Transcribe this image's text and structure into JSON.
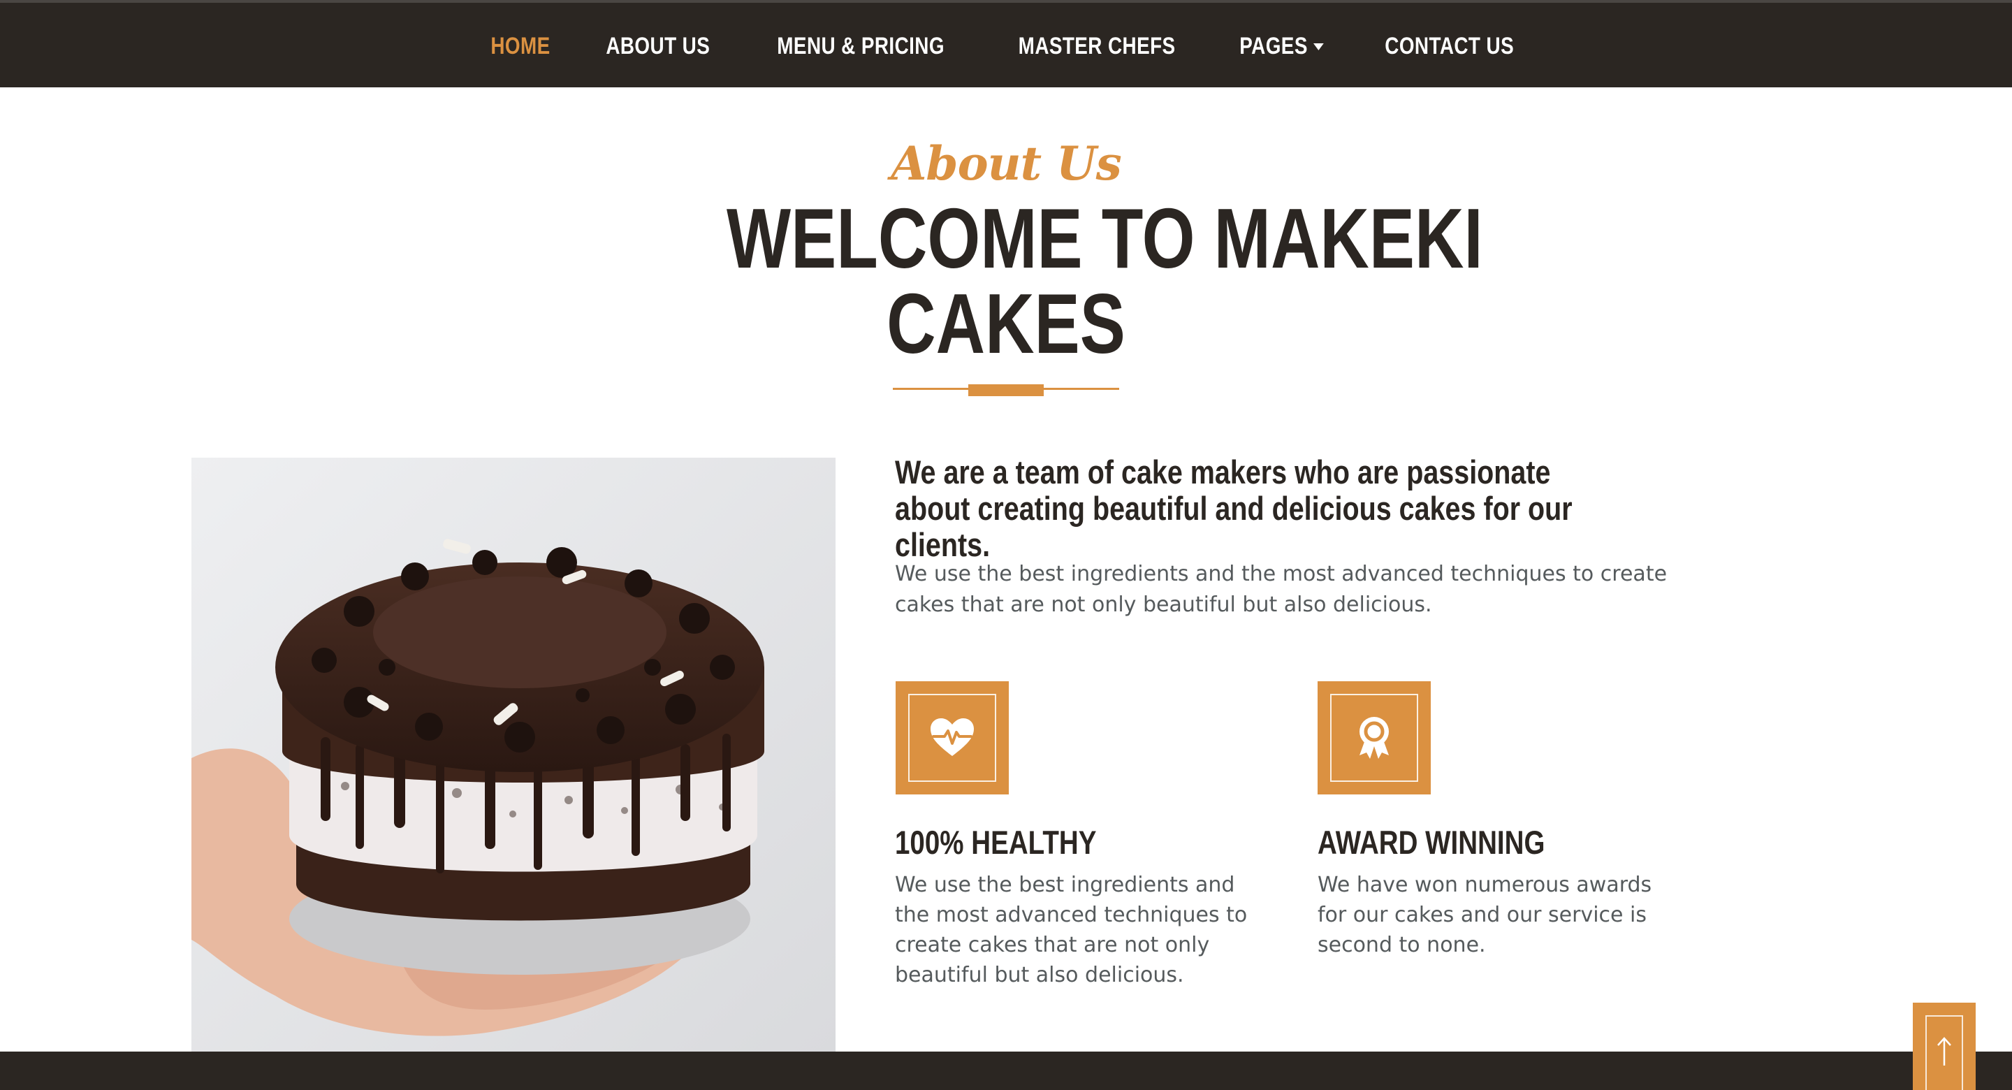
{
  "nav": {
    "items": [
      {
        "label": "HOME",
        "active": true
      },
      {
        "label": "ABOUT US"
      },
      {
        "label": "MENU & PRICING"
      },
      {
        "label": "MASTER CHEFS"
      },
      {
        "label": "PAGES",
        "has_dropdown": true
      },
      {
        "label": "CONTACT US"
      }
    ]
  },
  "about": {
    "eyebrow": "About Us",
    "title_line1": "WELCOME TO MAKEKI",
    "title_line2": "CAKES",
    "lead": "We are a team of cake makers who are passionate about creating beautiful and delicious cakes for our clients.",
    "description": "We use the best ingredients and the most advanced techniques to create cakes that are not only beautiful but also delicious."
  },
  "features": [
    {
      "icon": "heart-pulse-icon",
      "title": "100% HEALTHY",
      "text": "We use the best ingredients and the most advanced techniques to create cakes that are not only beautiful but also delicious."
    },
    {
      "icon": "award-icon",
      "title": "AWARD WINNING",
      "text": "We have won numerous awards for our cakes and our service is second to none."
    }
  ],
  "image": {
    "subject": "chocolate-cookies-cake"
  },
  "colors": {
    "accent": "#db9141",
    "dark": "#2b2622",
    "text": "#555a5c"
  },
  "back_to_top": {
    "icon": "arrow-up-icon"
  }
}
